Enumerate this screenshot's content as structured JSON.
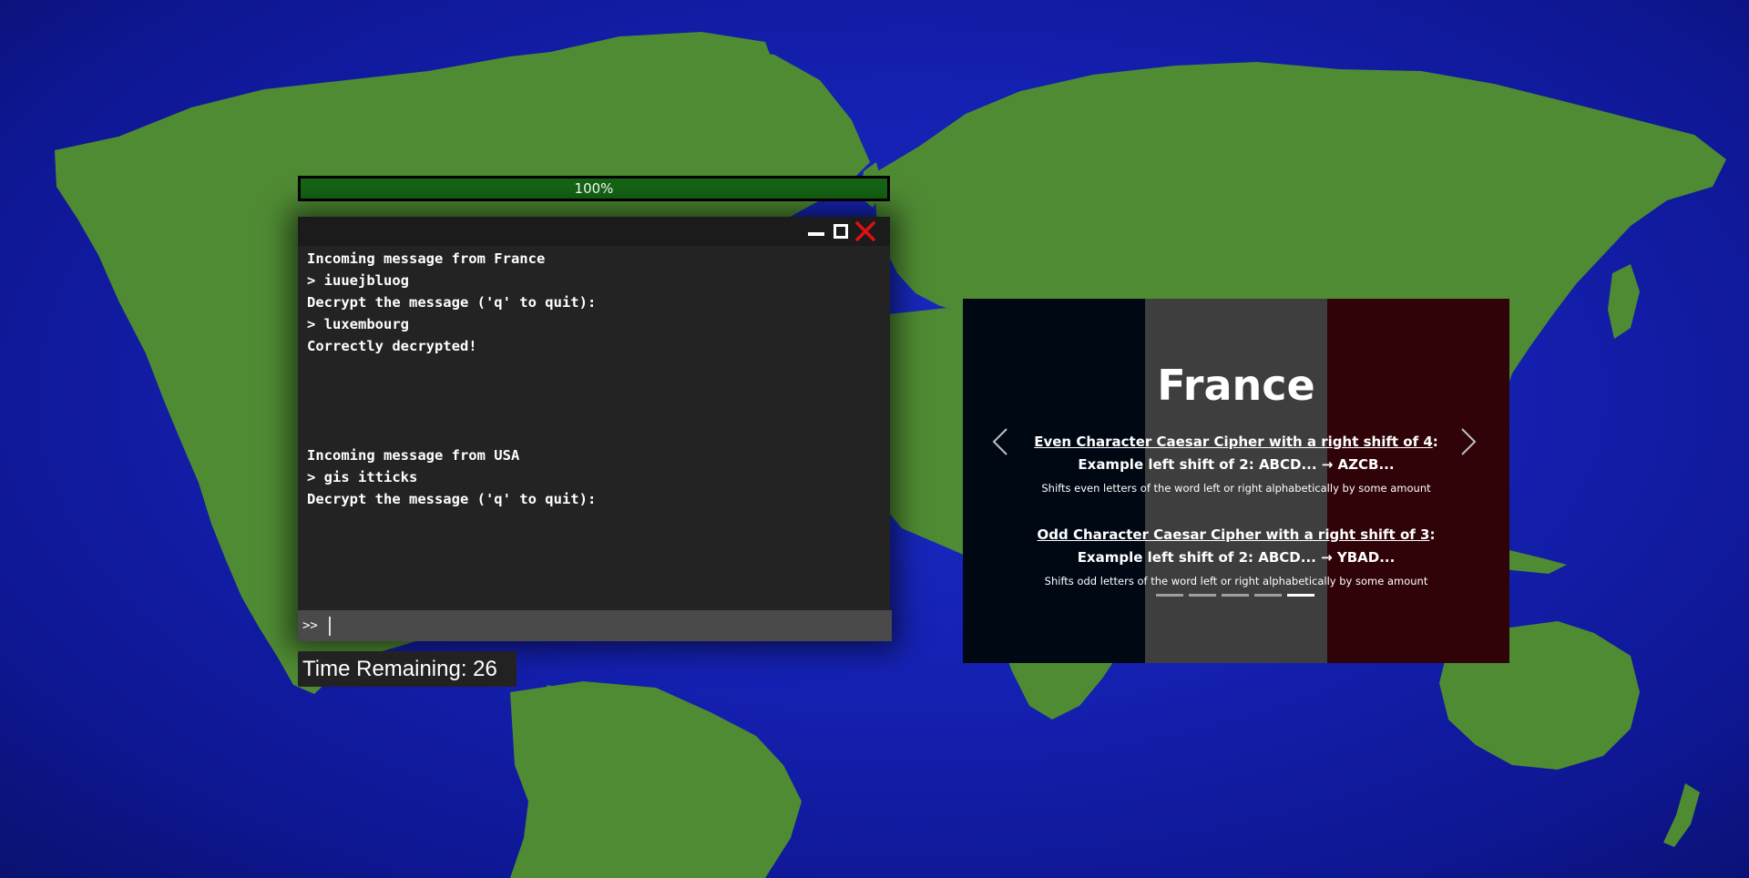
{
  "progress": {
    "percent_label": "100%",
    "fraction": 1.0,
    "fill_color": "#156515"
  },
  "terminal": {
    "lines": [
      "Incoming message from France",
      "> iuuejbluog",
      "Decrypt the message ('q' to quit):",
      "> luxembourg",
      "Correctly decrypted!",
      "",
      "",
      "",
      "",
      "Incoming message from USA",
      "> gis itticks",
      "Decrypt the message ('q' to quit):"
    ],
    "prompt": ">>",
    "input_value": "",
    "controls": {
      "minimize": "minimize-icon",
      "maximize": "maximize-icon",
      "close": "close-icon",
      "close_color": "#e01010"
    }
  },
  "timer": {
    "label": "Time Remaining: 26"
  },
  "carousel": {
    "title": "France",
    "flag_colors": [
      "#000814",
      "#3e3e3e",
      "#300308"
    ],
    "cipher1": {
      "name": "Even Character Caesar Cipher with a right shift of 4",
      "suffix": ":",
      "example": "Example left shift of 2: ABCD... → AZCB...",
      "description": "Shifts even letters of the word left or right alphabetically by some amount"
    },
    "cipher2": {
      "name": "Odd Character Caesar Cipher with a right shift of 3",
      "suffix": ":",
      "example": "Example left shift of 2: ABCD... → YBAD...",
      "description": "Shifts odd letters of the word left or right alphabetically by some amount"
    },
    "slide_count": 5,
    "active_slide": 5,
    "prev_icon": "chevron-left-icon",
    "next_icon": "chevron-right-icon"
  },
  "colors": {
    "ocean": "#1420b0",
    "land": "#4f8b33"
  }
}
